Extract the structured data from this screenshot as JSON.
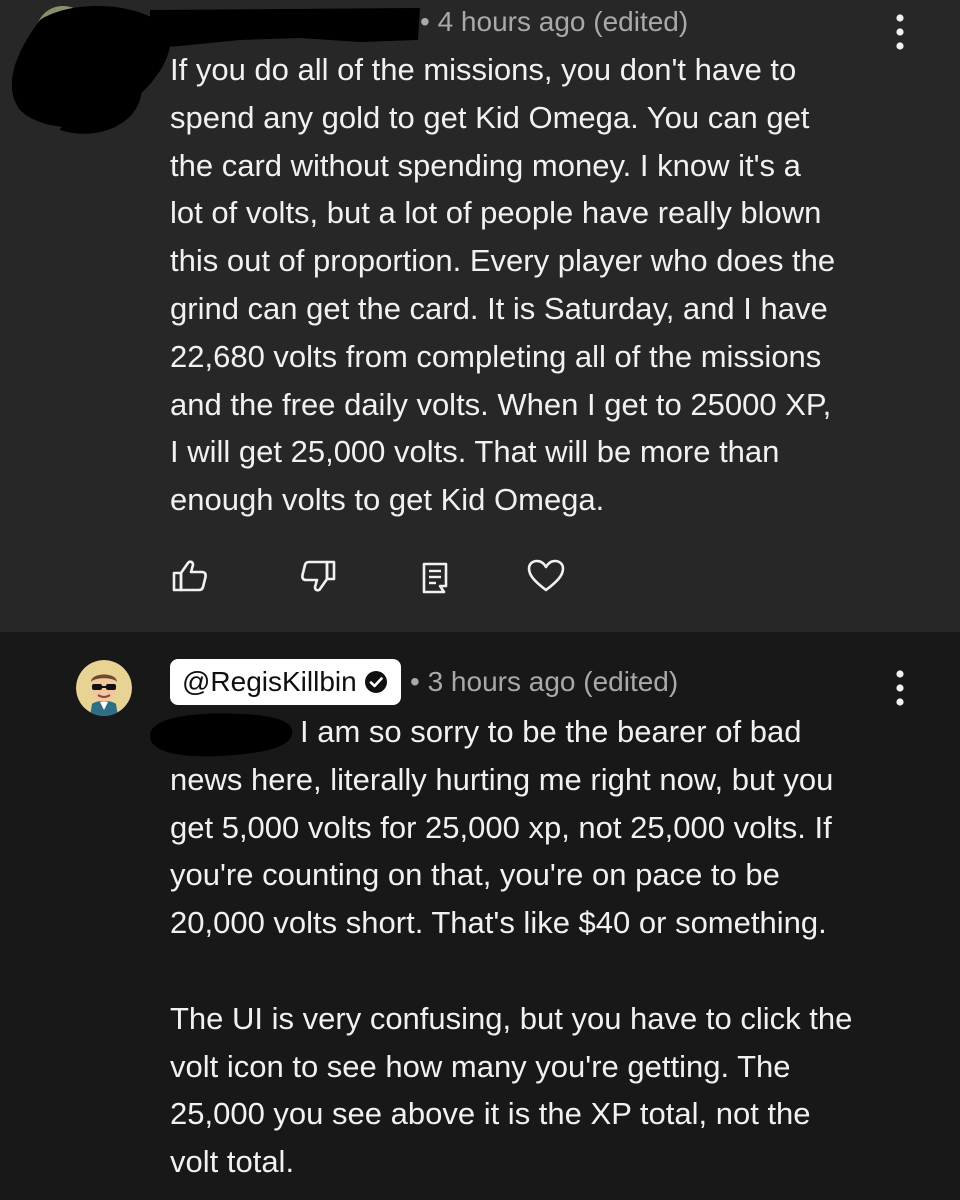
{
  "comments": [
    {
      "meta": "• 4 hours ago (edited)",
      "body": "If you do all of the missions, you don't have to\nspend any gold to get Kid Omega.  You can get\nthe card without spending money.  I know it's a\nlot of volts, but a lot of people have really blown\nthis out of proportion.  Every player who does the\ngrind can get the card.  It is Saturday, and I have\n22,680 volts from completing all of the missions\nand the free daily volts.  When I get to 25000 XP,\nI will get 25,000 volts.  That will be more than\nenough volts to get Kid Omega.",
      "actions": [
        "like-icon",
        "dislike-icon",
        "reply-icon",
        "heart-icon"
      ],
      "menu_icon": "more-vert-icon"
    },
    {
      "handle": "@RegisKillbin",
      "badge_icon": "verified-check-icon",
      "meta": "• 3 hours ago (edited)",
      "body": "I am so sorry to be the bearer of bad\nnews here, literally hurting me right now, but you\nget 5,000 volts for 25,000 xp, not 25,000 volts. If\nyou're counting on that, you're on pace to be\n20,000 volts short. That's like $40 or something.\n\nThe UI is very confusing, but you have to click the\nvolt icon to see how many you're getting. The\n25,000 you see above it is the XP total, not the\nvolt total.",
      "menu_icon": "more-vert-icon"
    }
  ],
  "colors": {
    "comment_bg_top": "#272727",
    "comment_bg_bottom": "#181818",
    "text": "#f1f1f1",
    "meta": "#a9a9a9"
  }
}
